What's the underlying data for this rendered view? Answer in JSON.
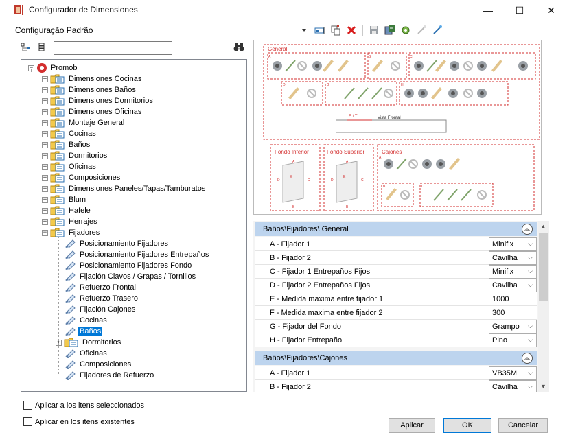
{
  "window": {
    "title": "Configurador de Dimensiones",
    "min": "—",
    "max": "☐",
    "close": "✕"
  },
  "config_label": "Configuração Padrão",
  "tree": {
    "search_value": "",
    "root": "Promob",
    "items": [
      "Dimensiones Cocinas",
      "Dimensiones Baños",
      "Dimensiones Dormitorios",
      "Dimensiones Oficinas",
      "Montaje General",
      "Cocinas",
      "Baños",
      "Dormitorios",
      "Oficinas",
      "Composiciones",
      "Dimensiones Paneles/Tapas/Tamburatos",
      "Blum",
      "Hafele",
      "Herrajes",
      "Fijadores"
    ],
    "fijadores_children": [
      "Posicionamiento Fijadores",
      "Posicionamiento Fijadores Entrepaños",
      "Posicionamiento Fijadores Fondo",
      "Fijación Clavos / Grapas / Tornillos",
      "Refuerzo Frontal",
      "Refuerzo Trasero",
      "Fijación Cajones",
      "Cocinas",
      "Baños",
      "Dormitorios",
      "Oficinas",
      "Composiciones",
      "Fijadores de Refuerzo"
    ],
    "selected": "Baños"
  },
  "preview": {
    "general": "General",
    "vista_frontal": "Vista Frontal",
    "et": "E / T",
    "fondo_inferior": "Fondo Inferior",
    "fondo_superior": "Fondo Superior",
    "cajones": "Cajones",
    "letters": {
      "a": "A",
      "b": "B",
      "c": "C",
      "d": "D",
      "e": "E",
      "g": "G",
      "h": "H"
    }
  },
  "grid": {
    "section1": "Baños\\Fijadores\\ General",
    "rows1": [
      {
        "name": "A - Fijador 1",
        "value": "Minifix",
        "combo": true
      },
      {
        "name": "B - Fijador 2",
        "value": "Cavilha",
        "combo": true
      },
      {
        "name": "C - Fijador 1 Entrepaños Fijos",
        "value": "Minifix",
        "combo": true
      },
      {
        "name": "D - Fijador 2 Entrepaños Fijos",
        "value": "Cavilha",
        "combo": true
      },
      {
        "name": "E - Medida maxima entre fijador 1",
        "value": "1000",
        "combo": false
      },
      {
        "name": "F - Medida maxima entre fijador 2",
        "value": "300",
        "combo": false
      },
      {
        "name": "G - Fijador del Fondo",
        "value": "Grampo",
        "combo": true
      },
      {
        "name": "H - Fijador Entrepaño",
        "value": "Pino",
        "combo": true
      }
    ],
    "section2": "Baños\\Fijadores\\Cajones",
    "rows2": [
      {
        "name": "A - Fijador 1",
        "value": "VB35M",
        "combo": true
      },
      {
        "name": "B - Fijador 2",
        "value": "Cavilha",
        "combo": true
      }
    ]
  },
  "options": {
    "apply_selected": "Aplicar a los itens seleccionados",
    "apply_existing": "Aplicar en los itens existentes"
  },
  "buttons": {
    "apply": "Aplicar",
    "ok": "OK",
    "cancel": "Cancelar"
  },
  "colors": {
    "accent": "#0078d7",
    "section": "#bdd4ee",
    "dashed": "#d32f2f"
  }
}
